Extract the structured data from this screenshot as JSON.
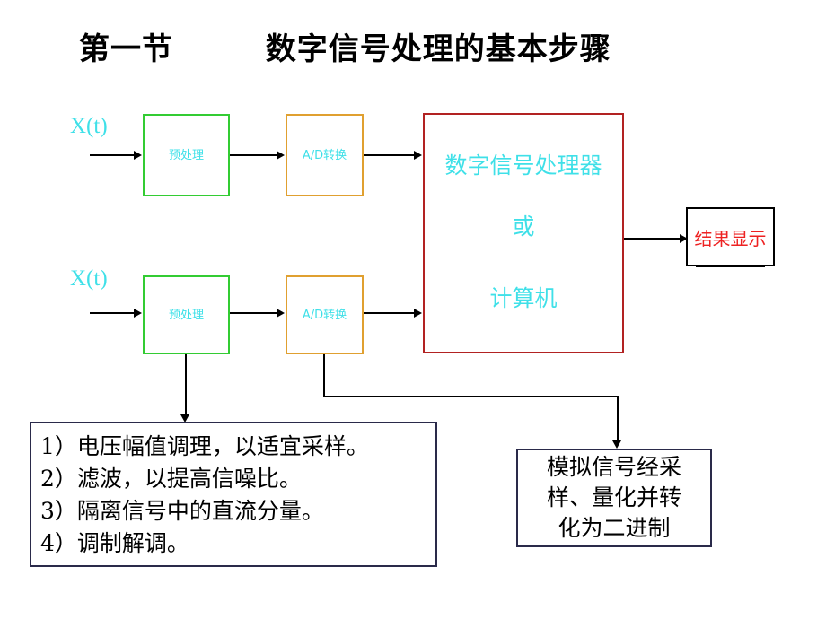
{
  "slide": {
    "title": "第一节        数字信号处理的基本步骤",
    "background_color": "#ffffff"
  },
  "colors": {
    "preprocess_border": "#33cc33",
    "adc_border": "#e0a030",
    "dsp_border": "#b22222",
    "cyan_text": "#3fe0e8",
    "result_text": "#ee2222",
    "note_border": "#2a2a4a",
    "line": "#000000"
  },
  "diagram": {
    "channels": [
      {
        "input_label": "X(t)",
        "preprocess_label": "预处理",
        "adc_label": "A/D转换"
      },
      {
        "input_label": "X(t)",
        "preprocess_label": "预处理",
        "adc_label": "A/D转换"
      }
    ],
    "dsp_box": {
      "line1": "数字信号处理器",
      "line2": "或",
      "line3": "计算机"
    },
    "result_box": {
      "label": "结果显示"
    }
  },
  "notes": {
    "preprocess_note": {
      "lines": [
        "1）电压幅值调理，以适宜采样。",
        "2）滤波，以提高信噪比。",
        "3）隔离信号中的直流分量。",
        "4）调制解调。"
      ]
    },
    "adc_note": {
      "lines": [
        "模拟信号经采",
        "样、量化并转",
        "化为二进制"
      ]
    }
  }
}
